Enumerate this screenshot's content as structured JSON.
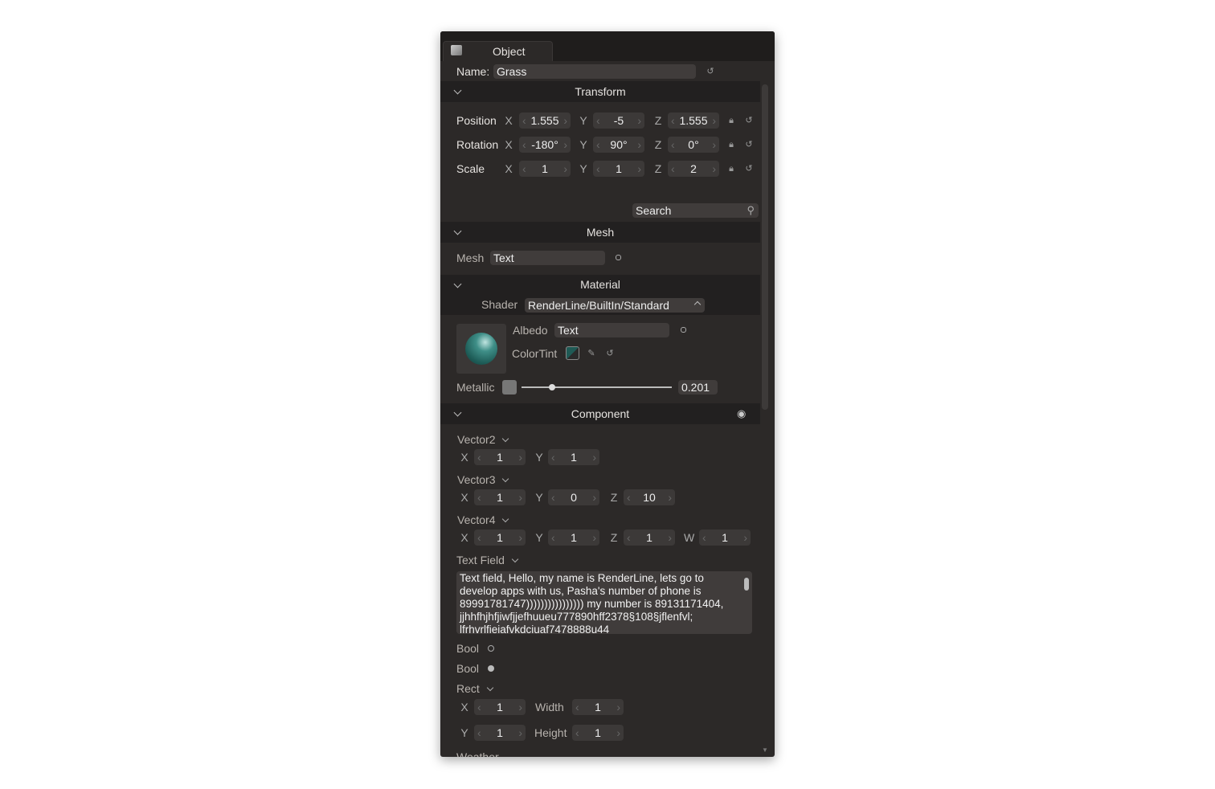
{
  "tab": {
    "label": "Object"
  },
  "name": {
    "label": "Name:",
    "value": "Grass"
  },
  "transform": {
    "title": "Transform",
    "rows": [
      {
        "label": "Position",
        "x": "1.555",
        "y": "-5",
        "z": "1.555"
      },
      {
        "label": "Rotation",
        "x": "-180°",
        "y": "90°",
        "z": "0°"
      },
      {
        "label": "Scale",
        "x": "1",
        "y": "1",
        "z": "2"
      }
    ],
    "axes": {
      "x": "X",
      "y": "Y",
      "z": "Z",
      "w": "W"
    }
  },
  "search": {
    "placeholder": "Search"
  },
  "mesh": {
    "title": "Mesh",
    "label": "Mesh",
    "value": "Text"
  },
  "material": {
    "title": "Material",
    "shader_label": "Shader",
    "shader_value": "RenderLine/BuiltIn/Standard",
    "albedo_label": "Albedo",
    "albedo_value": "Text",
    "colortint_label": "ColorTint",
    "colortint": "#1f5a55",
    "metallic_label": "Metallic",
    "metallic_value": "0.201",
    "metallic_fraction": 0.201
  },
  "component": {
    "title": "Component",
    "vector2": {
      "label": "Vector2",
      "x": "1",
      "y": "1"
    },
    "vector3": {
      "label": "Vector3",
      "x": "1",
      "y": "0",
      "z": "10"
    },
    "vector4": {
      "label": "Vector4",
      "x": "1",
      "y": "1",
      "z": "1",
      "w": "1"
    },
    "textfield": {
      "label": "Text Field",
      "value": "Text field, Hello, my name is RenderLine, lets go to develop apps with us, Pasha's number of phone is 89991781747)))))))))))))))) my number is 89131171404, jjhhfhjhfjiwfjjefhuueu777890hff2378§108§jflenfvl; lfrhvrlfieiafvkdciuaf7478888u44"
    },
    "bool1": {
      "label": "Bool",
      "checked": false
    },
    "bool2": {
      "label": "Bool",
      "checked": true
    },
    "rect": {
      "label": "Rect",
      "x": "1",
      "y": "1",
      "width_label": "Width",
      "width": "1",
      "height_label": "Height",
      "height": "1"
    },
    "weather": {
      "label": "Weather"
    }
  }
}
